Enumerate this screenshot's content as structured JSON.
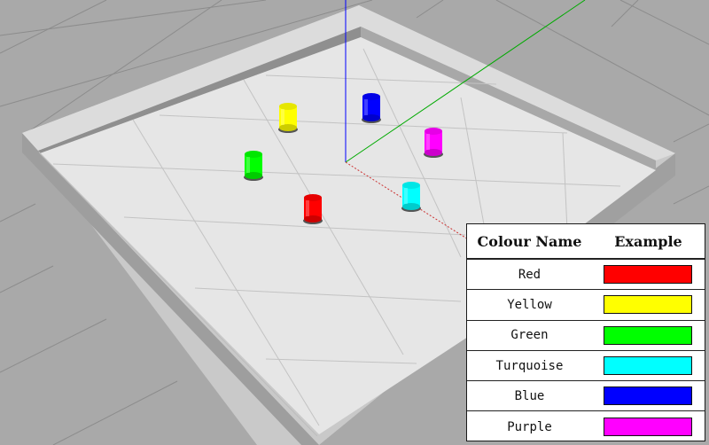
{
  "legend": {
    "headers": {
      "name": "Colour Name",
      "example": "Example"
    },
    "rows": [
      {
        "name": "Red",
        "color": "#ff0000"
      },
      {
        "name": "Yellow",
        "color": "#ffff00"
      },
      {
        "name": "Green",
        "color": "#00ff00"
      },
      {
        "name": "Turquoise",
        "color": "#00ffff"
      },
      {
        "name": "Blue",
        "color": "#0000ff"
      },
      {
        "name": "Purple",
        "color": "#ff00ff"
      }
    ]
  },
  "scene": {
    "cylinders": [
      {
        "name": "yellow-cylinder",
        "color": "#ffff00"
      },
      {
        "name": "blue-cylinder",
        "color": "#0000ff"
      },
      {
        "name": "purple-cylinder",
        "color": "#ff00ff"
      },
      {
        "name": "green-cylinder",
        "color": "#00ff00"
      },
      {
        "name": "turquoise-cylinder",
        "color": "#00ffff"
      },
      {
        "name": "red-cylinder",
        "color": "#ff0000"
      }
    ],
    "axes": {
      "z": "#0000ff",
      "y": "#00aa00",
      "x": "#cc3333"
    }
  }
}
